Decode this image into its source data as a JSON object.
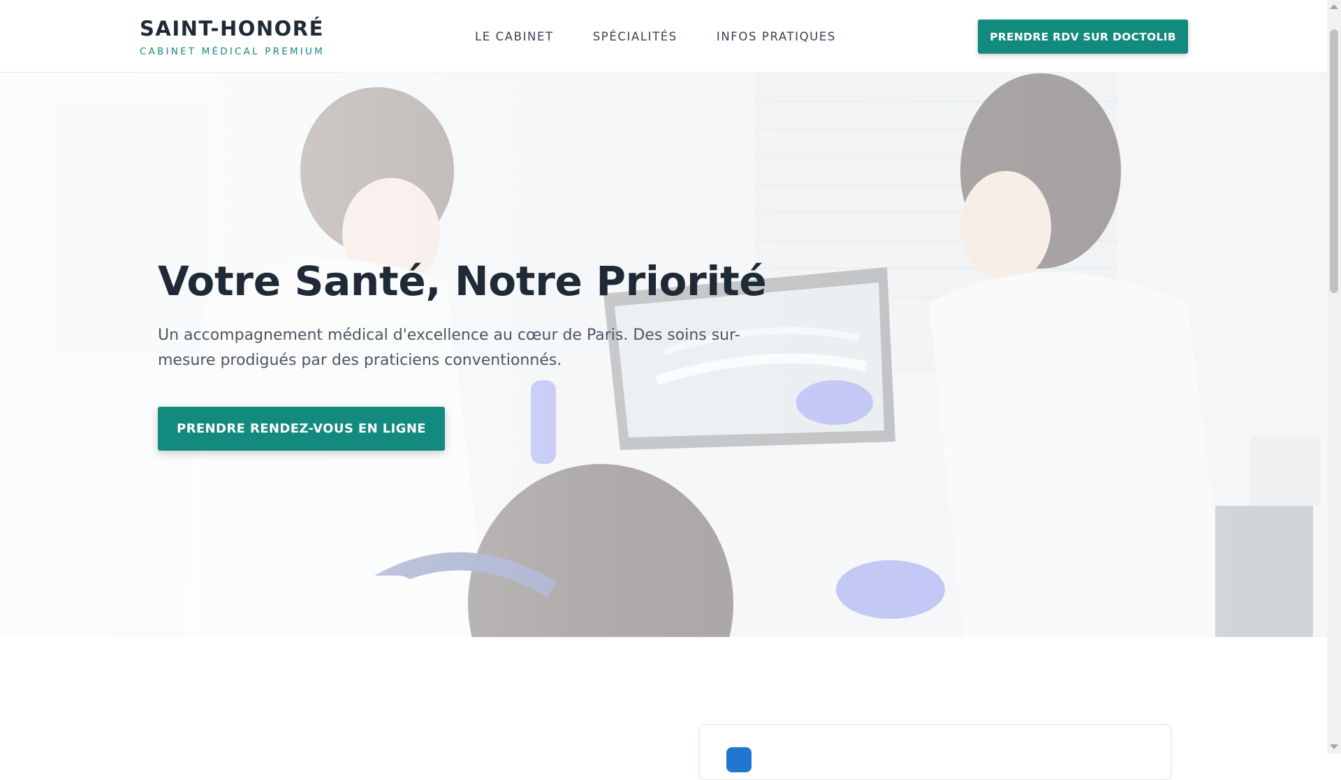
{
  "brand": {
    "name": "SAINT-HONORÉ",
    "tagline": "CABINET MÉDICAL PREMIUM"
  },
  "nav": {
    "items": [
      {
        "label": "LE CABINET"
      },
      {
        "label": "SPÉCIALITÉS"
      },
      {
        "label": "INFOS PRATIQUES"
      }
    ],
    "cta_label": "PRENDRE RDV SUR DOCTOLIB"
  },
  "hero": {
    "title": "Votre Santé, Notre Priorité",
    "subtitle": "Un accompagnement médical d'excellence au cœur de Paris. Des soins sur-mesure prodigués par des praticiens conventionnés.",
    "cta_label": "PRENDRE RENDEZ-VOUS EN LIGNE"
  },
  "colors": {
    "accent": "#138a7e",
    "heading": "#1f2a37",
    "text": "#4b5563"
  }
}
